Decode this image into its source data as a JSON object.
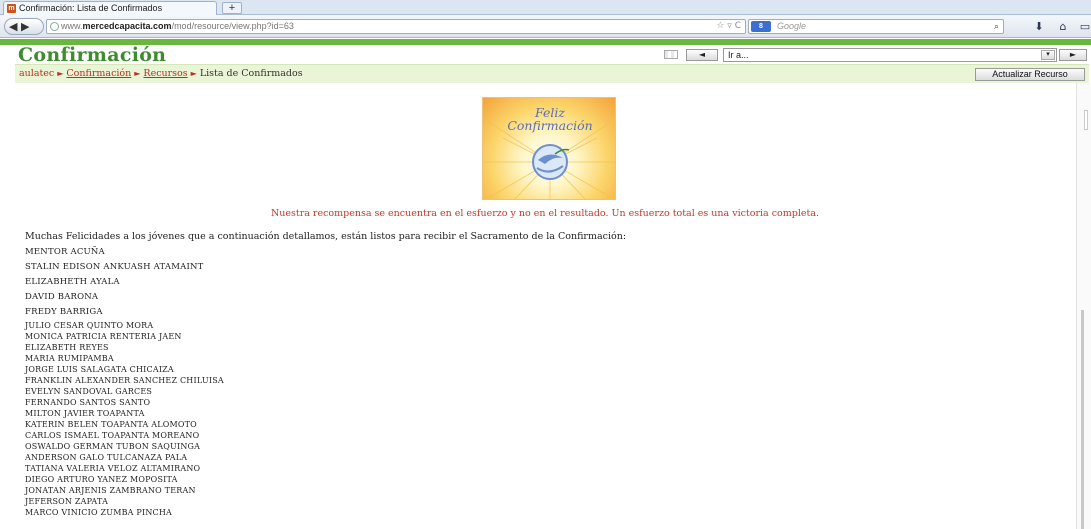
{
  "browser": {
    "tab_title": "Confirmación: Lista de Confirmados",
    "favicon_label": "m",
    "new_tab": "+",
    "back_forward": "◀ ▶",
    "url_prefix": "www.",
    "url_host": "mercedcapacita.com",
    "url_path": "/mod/resource/view.php?id=63",
    "search_engine": "8",
    "search_placeholder": "Google",
    "icons": {
      "globe": "globe-icon",
      "bookmark_star": "star-icon",
      "reload": "reload-icon",
      "search": "search-icon",
      "download": "download-icon",
      "home": "home-icon"
    }
  },
  "header": {
    "title": "Confirmación",
    "jump_prev": "◄",
    "jump_select_value": "Ir a...",
    "jump_next": "►"
  },
  "breadcrumb": {
    "items": [
      "aulatec",
      "Confirmación",
      "Recursos"
    ],
    "current": "Lista de Confirmados",
    "separator": "►"
  },
  "update_button": "Actualizar Recurso",
  "card": {
    "title_line1": "Feliz",
    "title_line2": "Confirmación"
  },
  "quote": "Nuestra recompensa se encuentra en el esfuerzo y no en el resultado. Un esfuerzo total es una victoria completa.",
  "intro": "Muchas Felicidades a los jóvenes que a continuación detallamos, están listos para recibir el Sacramento de la Confirmación:",
  "names": [
    "MENTOR ACUÑA",
    "STALIN EDISON ANKUASH ATAMAINT",
    "ELIZABHETH AYALA",
    "DAVID BARONA",
    "FREDY BARRIGA",
    "JULIO CESAR QUINTO MORA",
    "MONICA PATRICIA RENTERIA JAEN",
    "ELIZABETH REYES",
    "MARIA RUMIPAMBA",
    "JORGE LUIS SALAGATA CHICAIZA",
    "FRANKLIN ALEXANDER SANCHEZ CHILUISA",
    "EVELYN SANDOVAL GARCES",
    "FERNANDO SANTOS SANTO",
    "MILTON JAVIER TOAPANTA",
    "KATERIN BELEN TOAPANTA ALOMOTO",
    "CARLOS ISMAEL TOAPANTA MOREANO",
    "OSWALDO GERMAN TUBON SAQUINGA",
    "ANDERSON GALO TULCANAZA PALA",
    "TATIANA VALERIA VELOZ ALTAMIRANO",
    "DIEGO ARTURO YANEZ MOPOSITA",
    "JONATAN ARJENIS ZAMBRANO TERAN",
    "JEFERSON ZAPATA",
    "MARCO VINICIO ZUMBA PINCHA"
  ],
  "colors": {
    "accent_green": "#69b73f",
    "title_green": "#3f8c2e",
    "link_red": "#b5331b",
    "quote_red": "#c0392b",
    "nav_strip": "#eaf4d6"
  }
}
